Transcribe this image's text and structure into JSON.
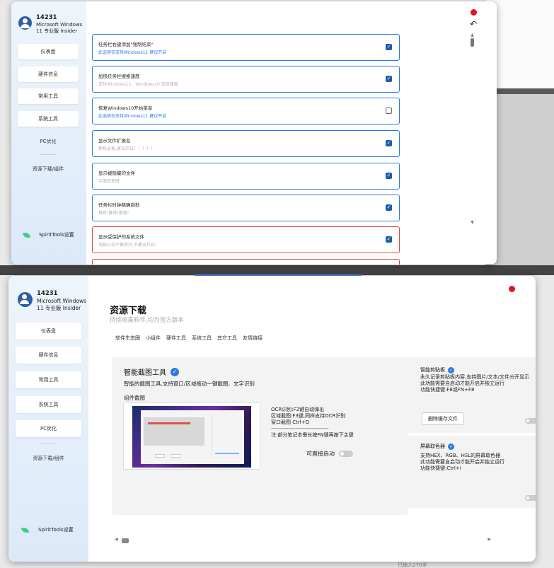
{
  "user": {
    "id": "14231",
    "os_line1": "Microsoft Windows",
    "os_line2": "11 专业版 Insider"
  },
  "sidebar": {
    "items": [
      {
        "label": "仪表盘"
      },
      {
        "label": "硬件信息"
      },
      {
        "label": "常用工具"
      },
      {
        "label": "系统工具"
      },
      {
        "label": "PC优化"
      },
      {
        "label": "资源下载/组件"
      }
    ],
    "settings_label": "SpiritTools设置"
  },
  "settings_window": {
    "undo_glyph": "↶",
    "options": [
      {
        "title": "任务栏右键添加\"强制结束\"",
        "desc": "此选项仅支持Windows11 建议开启",
        "desc_style": "blue",
        "checked": true,
        "style": "normal"
      },
      {
        "title": "加快任务栏搜索速度",
        "desc": "支持Windows11、Windows10 加快速度",
        "desc_style": "grey",
        "checked": true,
        "style": "normal"
      },
      {
        "title": "恢复Windows10开始菜单",
        "desc": "此选项仅支持Windows11 建议开启",
        "desc_style": "blue",
        "checked": false,
        "style": "normal"
      },
      {
        "title": "显示文件扩展名",
        "desc": "新机必备,建议开启！！！！！",
        "desc_style": "grey",
        "checked": true,
        "style": "normal"
      },
      {
        "title": "显示被隐藏的文件",
        "desc": "字面意思呀",
        "desc_style": "grey",
        "checked": true,
        "style": "normal"
      },
      {
        "title": "任务栏时钟精确到秒",
        "desc": "推荐!推荐!推荐!",
        "desc_style": "grey",
        "checked": true,
        "style": "normal"
      },
      {
        "title": "显示受保护的系统文件",
        "desc": "电脑小白不推荐开,不建议开启!",
        "desc_style": "grey",
        "checked": true,
        "style": "warn"
      }
    ]
  },
  "resources": {
    "title": "资源下载",
    "subtitle": "持续收集软件,均为官方版本",
    "tabs": [
      "软件生态圈",
      "小组件",
      "硬件工具",
      "系统工具",
      "其它工具",
      "友情链接"
    ],
    "main_tool": {
      "name": "智能截图工具",
      "description": "智能的截图工具,支持窗口/区域拖动一键截图、文字识别",
      "screenshot_label": "组件截图",
      "info_lines": [
        "OCR识别:F2键自动弹出",
        "区域截图:F3键,同样支持OCR识别",
        "窗口截图 Ctrl+Q"
      ],
      "divider": "----------------------------------------",
      "note": "注:部分笔记本需长按FN键再按下主键",
      "autostart_label": "可直接启动"
    },
    "side_tools": [
      {
        "name": "智能剪贴板",
        "lines": [
          "永久记录剪贴板内容,支持图片/文本/文件分开显示",
          "此功能需要自启动才能开启并独立运行",
          "功能快捷键:F8或FN+F8"
        ],
        "button": "删除缓存文件"
      },
      {
        "name": "屏幕取色器",
        "lines": [
          "支持HEX、RGB、HSL的屏幕取色器",
          "此功能需要自启动才能开启并独立运行",
          "功能快捷键:Ctrl+i"
        ]
      }
    ]
  },
  "scroll": {
    "left": "◀",
    "right": "▶",
    "up": "▲",
    "down": "▼"
  },
  "status": {
    "char_count": "已输入270字"
  },
  "colors": {
    "accent": "#2c7be5",
    "warn": "#e0473b",
    "close_dot": "#e81123",
    "checkbox": "#1d5ea8"
  }
}
